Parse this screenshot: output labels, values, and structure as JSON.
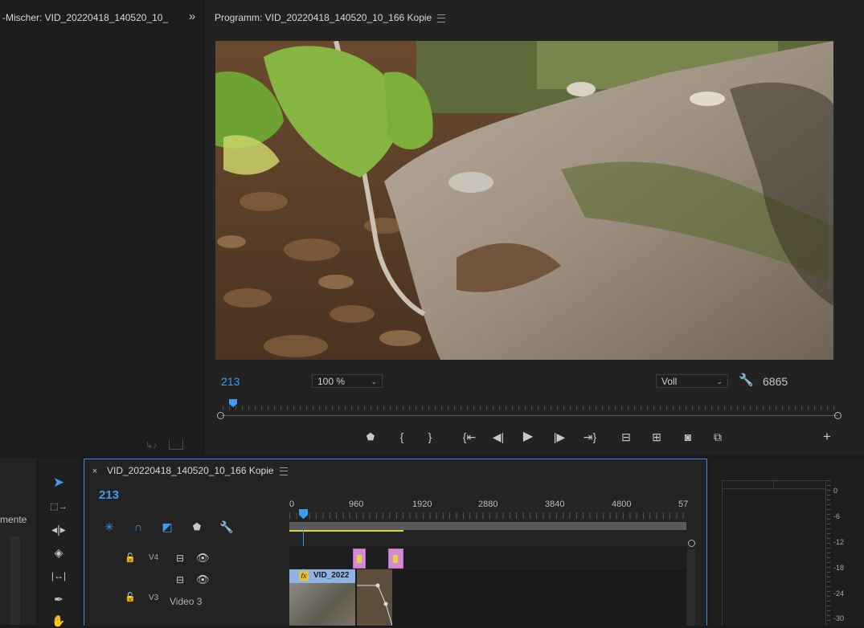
{
  "source_panel": {
    "title": "-Mischer: VID_20220418_140520_10_",
    "expand_icon": "double-chevron-right"
  },
  "program_monitor": {
    "title": "Programm: VID_20220418_140520_10_166 Kopie",
    "timecode_left": "213",
    "zoom": "100 %",
    "quality": "Voll",
    "timecode_right": "6865",
    "playhead_fraction": 0.02
  },
  "transport_buttons": [
    "marker",
    "mark-in",
    "mark-out",
    "go-to-in",
    "step-back",
    "play",
    "step-forward",
    "go-to-out",
    "lift",
    "extract",
    "export-frame",
    "compare",
    "add"
  ],
  "timeline": {
    "tab_title": "VID_20220418_140520_10_166 Kopie",
    "timecode": "213",
    "ruler_labels": [
      "0",
      "960",
      "1920",
      "2880",
      "3840",
      "4800",
      "57"
    ],
    "tracks": [
      {
        "lock": "lock-icon",
        "name": "V4",
        "label": ""
      },
      {
        "lock": "",
        "name": "",
        "label": ""
      },
      {
        "lock": "lock-icon",
        "name": "V3",
        "label": "Video 3"
      }
    ],
    "clip_label": "VID_2022",
    "fx_badge": "fx"
  },
  "left_panel": {
    "partial_label": "mente"
  },
  "audio_meter": {
    "db_labels": [
      "0",
      "-6",
      "-12",
      "-18",
      "-24",
      "-30"
    ]
  },
  "colors": {
    "accent": "#3c9cf0",
    "selection_border": "#2d8ceb",
    "clip_blue": "#8fb4e3",
    "clip_pink": "#d58ad8",
    "work_area_yellow": "#e3d23a"
  }
}
